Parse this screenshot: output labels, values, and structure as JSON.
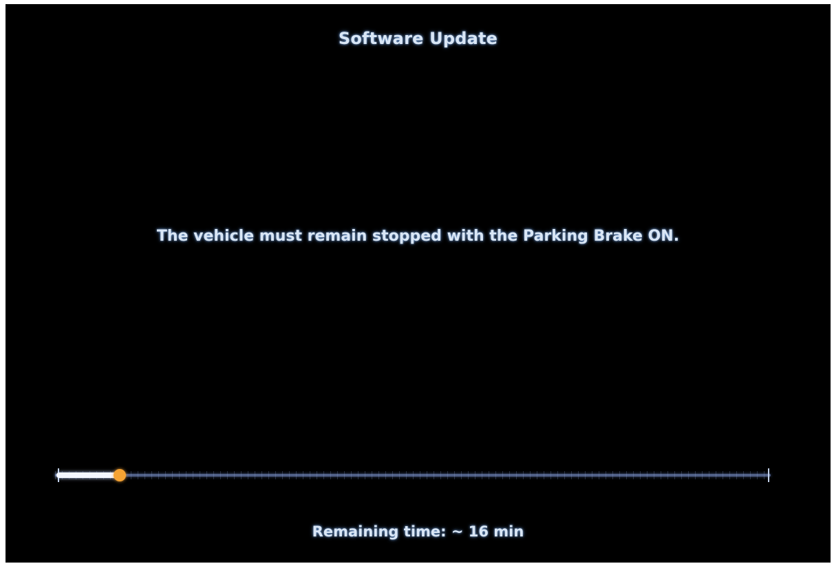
{
  "screen": {
    "title": "Software Update",
    "message": "The vehicle must remain stopped with the Parking Brake ON.",
    "remaining_time": "Remaining time: ~ 16 min"
  },
  "progress": {
    "fraction": 0.09,
    "fill_color": "#f4f7ff",
    "knob_color": "#f5a333",
    "track_color": "#4f5f86"
  },
  "colors": {
    "background": "#000000",
    "text": "#d9e6f5"
  }
}
